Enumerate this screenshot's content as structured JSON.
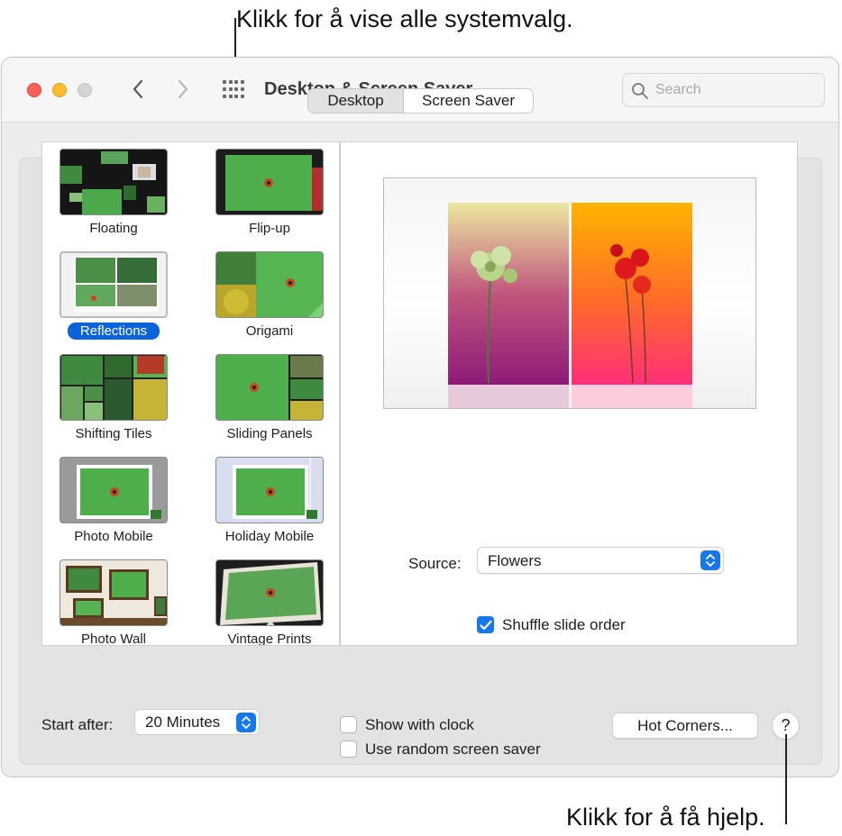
{
  "callouts": {
    "top": "Klikk for å vise alle systemvalg.",
    "bottom": "Klikk for å få hjelp."
  },
  "window": {
    "title": "Desktop & Screen Saver",
    "search_placeholder": "Search"
  },
  "tabs": [
    {
      "label": "Desktop",
      "selected": false
    },
    {
      "label": "Screen Saver",
      "selected": true
    }
  ],
  "screen_savers": [
    {
      "label": "Floating",
      "selected": false
    },
    {
      "label": "Flip-up",
      "selected": false
    },
    {
      "label": "Reflections",
      "selected": true
    },
    {
      "label": "Origami",
      "selected": false
    },
    {
      "label": "Shifting Tiles",
      "selected": false
    },
    {
      "label": "Sliding Panels",
      "selected": false
    },
    {
      "label": "Photo Mobile",
      "selected": false
    },
    {
      "label": "Holiday Mobile",
      "selected": false
    },
    {
      "label": "Photo Wall",
      "selected": false
    },
    {
      "label": "Vintage Prints",
      "selected": false
    }
  ],
  "options": {
    "source_label": "Source:",
    "source_value": "Flowers",
    "shuffle_label": "Shuffle slide order",
    "shuffle_checked": true
  },
  "footer": {
    "start_after_label": "Start after:",
    "start_after_value": "20 Minutes",
    "show_clock_label": "Show with clock",
    "show_clock_checked": false,
    "random_label": "Use random screen saver",
    "random_checked": false,
    "hot_corners_label": "Hot Corners...",
    "help_label": "?"
  },
  "colors": {
    "accent": "#1678f0",
    "selection": "#0a63d8",
    "close": "#ff5f57",
    "minimize": "#febc2e",
    "zoom": "#d4d4d4"
  }
}
